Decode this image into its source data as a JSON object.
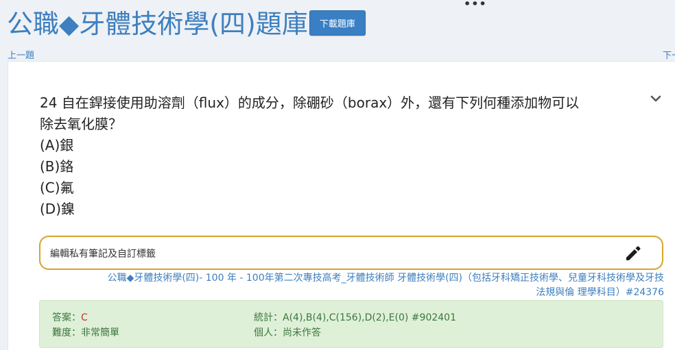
{
  "header": {
    "menu_icon": "more-dots-icon",
    "title": "公職◆牙體技術學(四)題庫",
    "download_label": "下載題庫"
  },
  "nav": {
    "prev_label": "上一題",
    "next_label": "下一題"
  },
  "question": {
    "stem_line1": "24 自在銲接使用助溶劑（flux）的成分，除硼砂（borax）外，還有下列何種添加物可以",
    "stem_line2": "除去氧化膜？",
    "options": [
      "(A)銀",
      "(B)鉻",
      "(C)氟",
      "(D)鎳"
    ],
    "expand_icon": "chevron-down-icon"
  },
  "note": {
    "label": "編輯私有筆記及自訂標籤",
    "edit_icon": "pencil-icon"
  },
  "source": {
    "line1": "公職◆牙體技術學(四)- 100 年 - 100年第二次專技高考_牙體技術師 牙體技術學(四)（包括牙科矯正技術學、兒童牙科技術學及牙技",
    "line2": "法規與倫 理學科目）#24376"
  },
  "answer": {
    "answer_label": "答案：",
    "answer_value": "C",
    "difficulty_label": "難度：",
    "difficulty_value": "非常簡單",
    "stats_label": "統計：",
    "stats_value": "A(4),B(4),C(156),D(2),E(0) #902401",
    "personal_label": "個人：",
    "personal_value": "尚未作答"
  },
  "colors": {
    "title_blue": "#3d7fbf",
    "button_blue": "#3a7fc4",
    "note_border": "#d4a52a",
    "answer_bg": "#dff0d8",
    "answer_text": "#3c763d",
    "answer_red": "#c9302c"
  }
}
